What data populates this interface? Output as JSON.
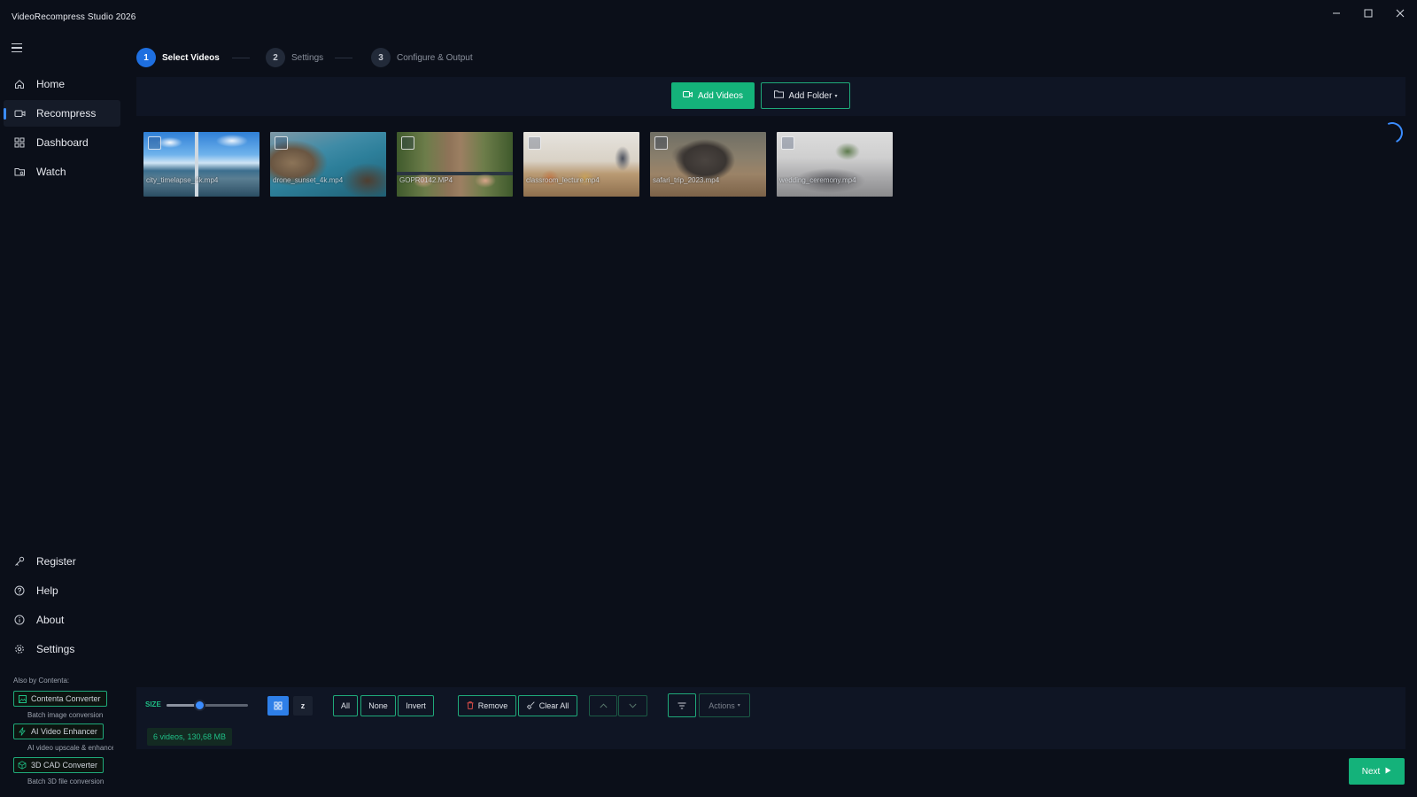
{
  "app": {
    "title": "VideoRecompress Studio 2026"
  },
  "window": {
    "minimize_icon": "minimize-icon",
    "maximize_icon": "maximize-icon",
    "close_icon": "close-icon"
  },
  "sidebar": {
    "menu_icon": "hamburger-icon",
    "items": [
      {
        "label": "Home",
        "icon": "home-icon",
        "active": false
      },
      {
        "label": "Recompress",
        "icon": "video-icon",
        "active": true
      },
      {
        "label": "Dashboard",
        "icon": "grid-icon",
        "active": false
      },
      {
        "label": "Watch",
        "icon": "folder-eye-icon",
        "active": false
      }
    ],
    "bottom_items": [
      {
        "label": "Register",
        "icon": "key-icon"
      },
      {
        "label": "Help",
        "icon": "help-icon"
      },
      {
        "label": "About",
        "icon": "info-icon"
      },
      {
        "label": "Settings",
        "icon": "gear-icon"
      }
    ],
    "also_by": "Also by Contenta:",
    "promos": [
      {
        "label": "Contenta Converter",
        "sub": "Batch image conversion",
        "icon": "image-icon"
      },
      {
        "label": "AI Video Enhancer",
        "sub": "AI video upscale & enhance",
        "icon": "bolt-icon"
      },
      {
        "label": "3D CAD Converter",
        "sub": "Batch 3D file conversion",
        "icon": "cube-icon"
      }
    ]
  },
  "steps": [
    {
      "num": "1",
      "label": "Select Videos",
      "active": true
    },
    {
      "num": "2",
      "label": "Settings",
      "active": false
    },
    {
      "num": "3",
      "label": "Configure & Output",
      "active": false
    }
  ],
  "toolbar": {
    "add_videos": "Add Videos",
    "add_folder": "Add Folder",
    "add_folder_caret": "▾"
  },
  "videos": [
    {
      "name": "city_timelapse_4k.mp4"
    },
    {
      "name": "drone_sunset_4k.mp4"
    },
    {
      "name": "GOPR0142.MP4"
    },
    {
      "name": "classroom_lecture.mp4"
    },
    {
      "name": "safari_trip_2023.mp4"
    },
    {
      "name": "wedding_ceremony.mp4"
    }
  ],
  "bottom": {
    "size_label": "SIZE",
    "size_value": 0.4,
    "grid_icon": "grid-view-icon",
    "sort_label": "z",
    "all": "All",
    "none": "None",
    "invert": "Invert",
    "remove": "Remove",
    "clear_all": "Clear All",
    "actions": "Actions",
    "actions_caret": "▾",
    "summary": "6 videos, 130,68 MB"
  },
  "footer": {
    "next": "Next"
  },
  "colors": {
    "accent_green": "#14b27a",
    "accent_blue": "#1e6fe0",
    "background": "#0b0f19"
  }
}
